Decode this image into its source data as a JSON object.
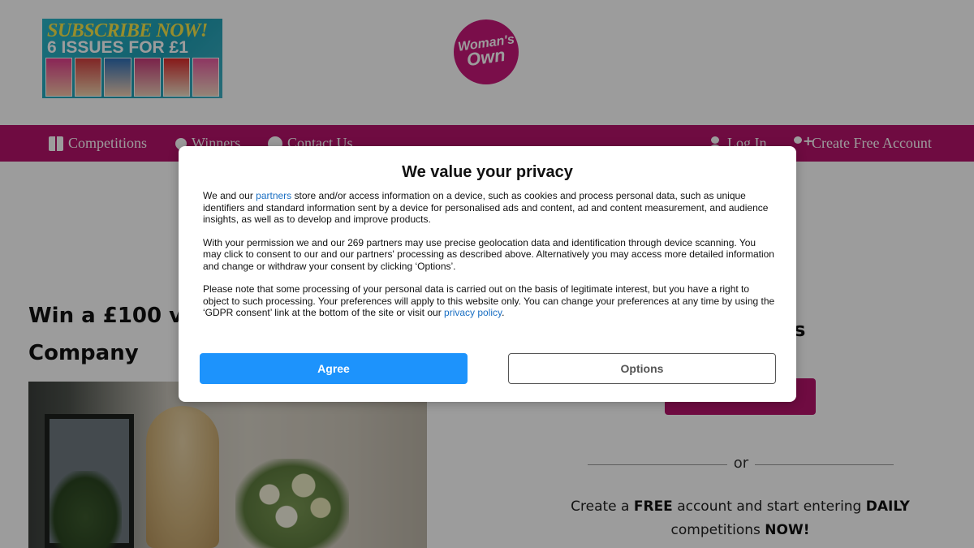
{
  "header": {
    "promo": {
      "line1": "SUBSCRIBE NOW!",
      "line2": "6 ISSUES FOR £1"
    },
    "logo": {
      "line1": "Woman's",
      "line2": "Own"
    }
  },
  "nav": {
    "left": [
      {
        "label": "Competitions",
        "icon": "gift-icon"
      },
      {
        "label": "Winners",
        "icon": "map-pin-icon"
      },
      {
        "label": "Contact Us",
        "icon": "question-circle-icon"
      }
    ],
    "right": [
      {
        "label": "Log In",
        "icon": "user-icon"
      },
      {
        "label": "Create Free Account",
        "icon": "user-plus-icon"
      }
    ]
  },
  "article": {
    "title_line1": "Win a £100 vou",
    "title_line2": "Company"
  },
  "sidebar": {
    "heading_fragment": "ers",
    "or_label": "or",
    "cta": {
      "part1": "Create a ",
      "free": "FREE",
      "part2": " account and start entering ",
      "daily": "DAILY",
      "part3": " competitions ",
      "now": "NOW!"
    }
  },
  "consent": {
    "title": "We value your privacy",
    "p1_before": "We and our ",
    "p1_link": "partners",
    "p1_after": " store and/or access information on a device, such as cookies and process personal data, such as unique identifiers and standard information sent by a device for personalised ads and content, ad and content measurement, and audience insights, as well as to develop and improve products.",
    "p2": "With your permission we and our 269 partners may use precise geolocation data and identification through device scanning. You may click to consent to our and our partners' processing as described above. Alternatively you may access more detailed information and change or withdraw your consent by clicking ‘Options’.",
    "p3_before": "Please note that some processing of your personal data is carried out on the basis of legitimate interest, but you have a right to object to such processing. Your preferences will apply to this website only. You can change your preferences at any time by using the ‘GDPR consent’ link at the bottom of the site or visit our ",
    "p3_link": "privacy policy",
    "p3_after": ".",
    "agree_label": "Agree",
    "options_label": "Options"
  },
  "colors": {
    "brand": "#b5126a",
    "agree_button": "#1d93fc",
    "link": "#1a6fc3"
  }
}
